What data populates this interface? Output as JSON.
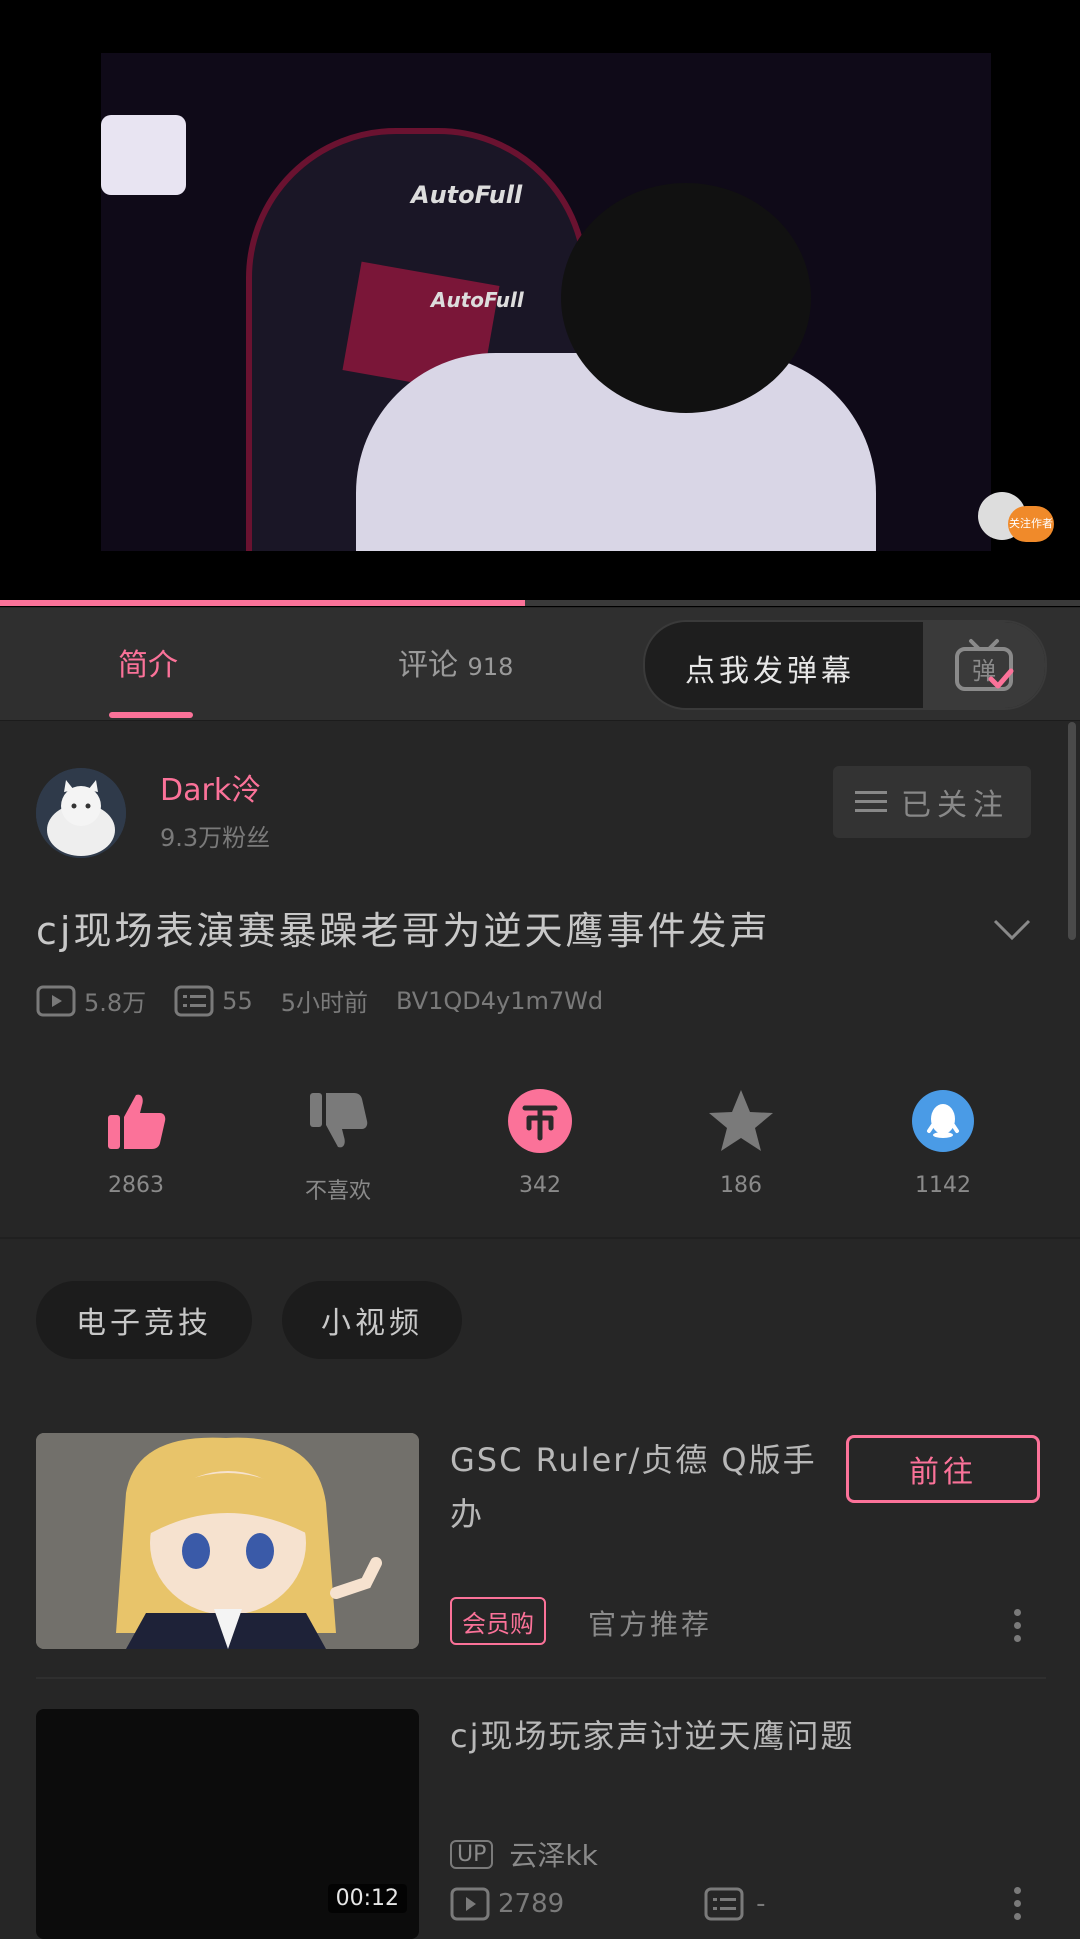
{
  "player": {
    "progress_fraction": 0.486,
    "follow_badge": "关注作者",
    "video_logos": [
      "AutoFull",
      "AutoFull"
    ]
  },
  "tabs": {
    "intro": "简介",
    "comments": "评论",
    "comments_count": "918",
    "danmaku_placeholder": "点我发弹幕",
    "danmaku_button": "弹"
  },
  "uploader": {
    "name": "Dark泠",
    "fans": "9.3万粉丝",
    "follow_label": "已关注"
  },
  "video": {
    "title": "cj现场表演赛暴躁老哥为逆天鹰事件发声",
    "views": "5.8万",
    "danmaku_count": "55",
    "time": "5小时前",
    "bvid": "BV1QD4y1m7Wd"
  },
  "actions": {
    "like": "2863",
    "dislike": "不喜欢",
    "coin": "342",
    "favorite": "186",
    "share": "1142"
  },
  "tags": [
    "电子竞技",
    "小视频"
  ],
  "recommendations": [
    {
      "title": "GSC Ruler/贞德 Q版手办",
      "goto_label": "前往",
      "badge": "会员购",
      "source": "官方推荐"
    },
    {
      "title": "cj现场玩家声讨逆天鹰问题",
      "up_badge": "UP",
      "uploader": "云泽kk",
      "views": "2789",
      "danmaku": "-",
      "duration": "00:12"
    }
  ],
  "colors": {
    "accent": "#fb7299",
    "share": "#4a9be6",
    "follow_badge": "#f08a2a"
  }
}
